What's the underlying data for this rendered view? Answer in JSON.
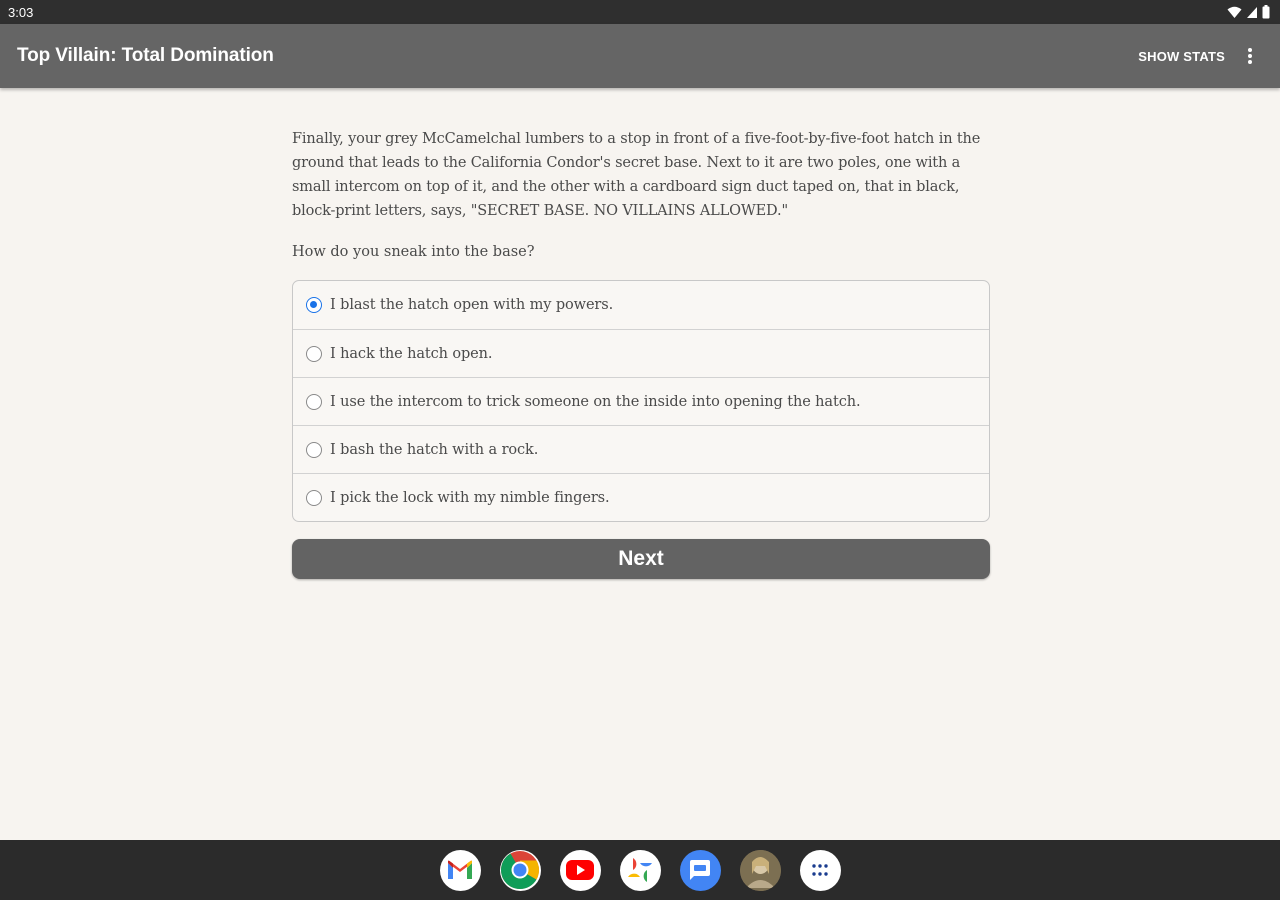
{
  "status_bar": {
    "time": "3:03",
    "icons": [
      "wifi-icon",
      "signal-icon",
      "battery-icon"
    ]
  },
  "app_bar": {
    "title": "Top Villain: Total Domination",
    "show_stats_label": "SHOW STATS",
    "menu_icon": "more-vert-icon"
  },
  "story": {
    "paragraph": "Finally, your grey McCamelchal lumbers to a stop in front of a five-foot-by-five-foot hatch in the ground that leads to the California Condor's secret base. Next to it are two poles, one with a small intercom on top of it, and the other with a cardboard sign duct taped on, that in black, block-print letters, says, \"SECRET BASE. NO VILLAINS ALLOWED.\"",
    "question": "How do you sneak into the base?"
  },
  "choices": [
    {
      "label": "I blast the hatch open with my powers.",
      "selected": true
    },
    {
      "label": "I hack the hatch open.",
      "selected": false
    },
    {
      "label": "I use the intercom to trick someone on the inside into opening the hatch.",
      "selected": false
    },
    {
      "label": "I bash the hatch with a rock.",
      "selected": false
    },
    {
      "label": "I pick the lock with my nimble fingers.",
      "selected": false
    }
  ],
  "next_button": {
    "label": "Next"
  },
  "dock": {
    "apps": [
      "gmail-icon",
      "chrome-icon",
      "youtube-icon",
      "photos-icon",
      "messages-icon",
      "avatar-icon",
      "app-drawer-icon"
    ]
  },
  "colors": {
    "app_bar": "#656565",
    "background": "#f7f4f0",
    "radio_selected": "#1a73e8",
    "button": "#636363"
  }
}
